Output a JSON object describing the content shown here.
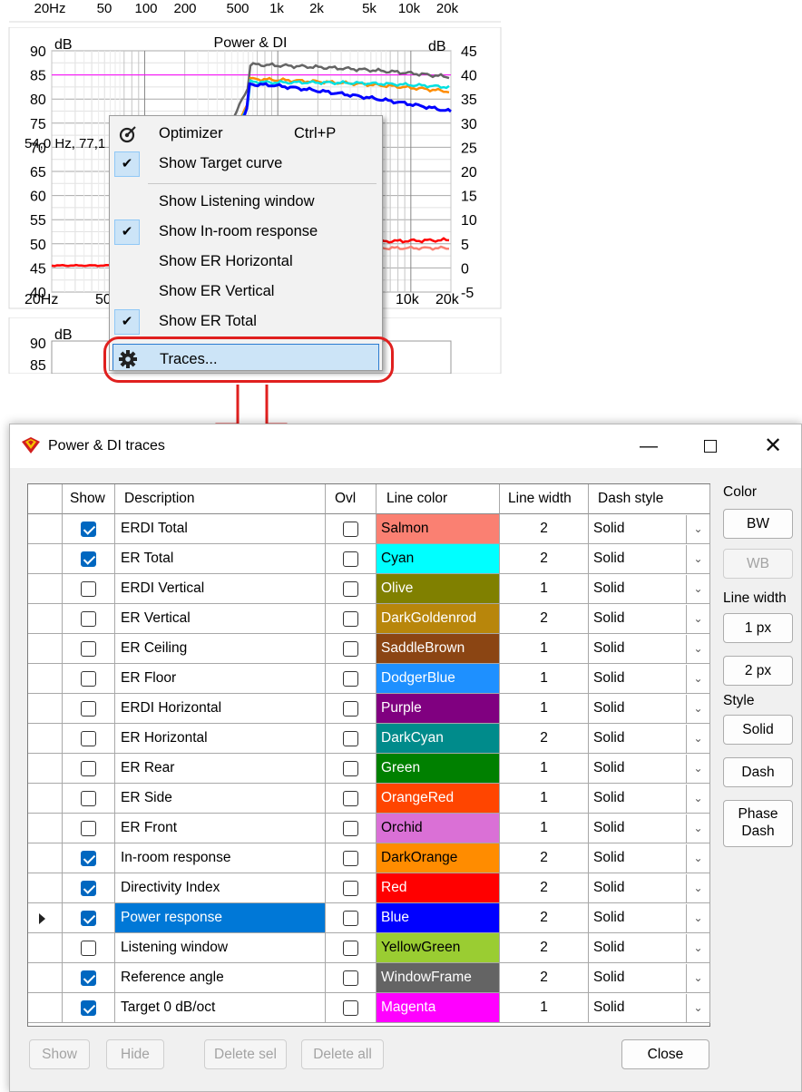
{
  "top_freq_labels": [
    "20Hz",
    "50",
    "100",
    "200",
    "500",
    "1k",
    "2k",
    "5k",
    "10k",
    "20k"
  ],
  "graph": {
    "title": "Power & DI",
    "left_unit": "dB",
    "right_unit": "dB",
    "left_ticks": [
      "90",
      "85",
      "80",
      "75",
      "70",
      "65",
      "60",
      "55",
      "50",
      "45",
      "40"
    ],
    "right_ticks": [
      "45",
      "40",
      "35",
      "30",
      "25",
      "20",
      "15",
      "10",
      "5",
      "0",
      "-5"
    ],
    "x_labels": [
      "20Hz",
      "50",
      "10k",
      "20k"
    ],
    "cursor_readout": "54,0 Hz, 77,1",
    "reference_line_color": "#ff00ff"
  },
  "graph2": {
    "tick_90": "90",
    "tick_85": "85",
    "unit": "dB"
  },
  "context_menu": {
    "optimizer": {
      "label": "Optimizer",
      "shortcut": "Ctrl+P",
      "icon": "target-icon"
    },
    "show_target_curve": {
      "label": "Show Target curve",
      "checked": true
    },
    "show_listening_window": {
      "label": "Show Listening window",
      "checked": false
    },
    "show_in_room_response": {
      "label": "Show In-room response",
      "checked": true
    },
    "show_er_horizontal": {
      "label": "Show ER Horizontal",
      "checked": false
    },
    "show_er_vertical": {
      "label": "Show ER Vertical",
      "checked": false
    },
    "show_er_total": {
      "label": "Show ER Total",
      "checked": true
    },
    "traces": {
      "label": "Traces...",
      "icon": "gear-icon",
      "highlighted": true
    }
  },
  "annotation": {
    "color": "#e0201f"
  },
  "dialog": {
    "title": "Power & DI traces",
    "columns": {
      "show": "Show",
      "description": "Description",
      "ovl": "Ovl",
      "line_color": "Line color",
      "line_width": "Line width",
      "dash_style": "Dash style"
    },
    "rows": [
      {
        "show": true,
        "description": "ERDI Total",
        "ovl": false,
        "color_name": "Salmon",
        "color": "#fa8072",
        "text_color": "#000000",
        "width": "2",
        "dash": "Solid"
      },
      {
        "show": true,
        "description": "ER Total",
        "ovl": false,
        "color_name": "Cyan",
        "color": "#00ffff",
        "text_color": "#000000",
        "width": "2",
        "dash": "Solid"
      },
      {
        "show": false,
        "description": "ERDI Vertical",
        "ovl": false,
        "color_name": "Olive",
        "color": "#808000",
        "text_color": "#ffffff",
        "width": "1",
        "dash": "Solid"
      },
      {
        "show": false,
        "description": "ER Vertical",
        "ovl": false,
        "color_name": "DarkGoldenrod",
        "color": "#b8860b",
        "text_color": "#ffffff",
        "width": "2",
        "dash": "Solid"
      },
      {
        "show": false,
        "description": "ER Ceiling",
        "ovl": false,
        "color_name": "SaddleBrown",
        "color": "#8b4513",
        "text_color": "#ffffff",
        "width": "1",
        "dash": "Solid"
      },
      {
        "show": false,
        "description": "ER Floor",
        "ovl": false,
        "color_name": "DodgerBlue",
        "color": "#1e90ff",
        "text_color": "#ffffff",
        "width": "1",
        "dash": "Solid"
      },
      {
        "show": false,
        "description": "ERDI Horizontal",
        "ovl": false,
        "color_name": "Purple",
        "color": "#800080",
        "text_color": "#ffffff",
        "width": "1",
        "dash": "Solid"
      },
      {
        "show": false,
        "description": "ER Horizontal",
        "ovl": false,
        "color_name": "DarkCyan",
        "color": "#008b8b",
        "text_color": "#ffffff",
        "width": "2",
        "dash": "Solid"
      },
      {
        "show": false,
        "description": "ER Rear",
        "ovl": false,
        "color_name": "Green",
        "color": "#008000",
        "text_color": "#ffffff",
        "width": "1",
        "dash": "Solid"
      },
      {
        "show": false,
        "description": "ER Side",
        "ovl": false,
        "color_name": "OrangeRed",
        "color": "#ff4500",
        "text_color": "#ffffff",
        "width": "1",
        "dash": "Solid"
      },
      {
        "show": false,
        "description": "ER Front",
        "ovl": false,
        "color_name": "Orchid",
        "color": "#da70d6",
        "text_color": "#000000",
        "width": "1",
        "dash": "Solid"
      },
      {
        "show": true,
        "description": "In-room response",
        "ovl": false,
        "color_name": "DarkOrange",
        "color": "#ff8c00",
        "text_color": "#000000",
        "width": "2",
        "dash": "Solid"
      },
      {
        "show": true,
        "description": "Directivity Index",
        "ovl": false,
        "color_name": "Red",
        "color": "#ff0000",
        "text_color": "#ffffff",
        "width": "2",
        "dash": "Solid"
      },
      {
        "show": true,
        "description": "Power response",
        "ovl": false,
        "color_name": "Blue",
        "color": "#0000ff",
        "text_color": "#ffffff",
        "width": "2",
        "dash": "Solid",
        "selected": true
      },
      {
        "show": false,
        "description": "Listening window",
        "ovl": false,
        "color_name": "YellowGreen",
        "color": "#9acd32",
        "text_color": "#000000",
        "width": "2",
        "dash": "Solid"
      },
      {
        "show": true,
        "description": "Reference angle",
        "ovl": false,
        "color_name": "WindowFrame",
        "color": "#646464",
        "text_color": "#ffffff",
        "width": "2",
        "dash": "Solid"
      },
      {
        "show": true,
        "description": "Target 0 dB/oct",
        "ovl": false,
        "color_name": "Magenta",
        "color": "#ff00ff",
        "text_color": "#ffffff",
        "width": "1",
        "dash": "Solid"
      }
    ],
    "side": {
      "color_label": "Color",
      "bw": "BW",
      "wb": "WB",
      "line_width_label": "Line width",
      "w1": "1 px",
      "w2": "2 px",
      "style_label": "Style",
      "solid": "Solid",
      "dash": "Dash",
      "phase_dash": "Phase Dash"
    },
    "bottom": {
      "show": "Show",
      "hide": "Hide",
      "delete_sel": "Delete sel",
      "delete_all": "Delete all",
      "close": "Close"
    }
  }
}
